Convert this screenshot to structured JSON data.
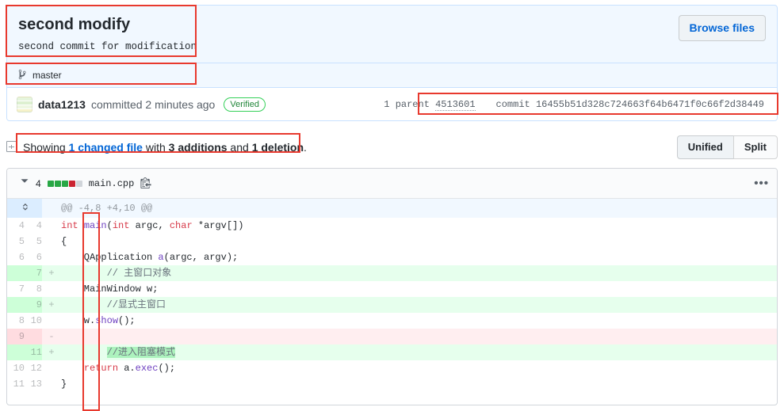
{
  "commit": {
    "title": "second modify",
    "description": "second commit for modification",
    "browse_files_label": "Browse files",
    "branch_icon": "git-branch-icon",
    "branch": "master",
    "author": "data1213",
    "committed_text": "committed 2 minutes ago",
    "verified_label": "Verified",
    "parent_label": "1 parent",
    "parent_sha": "4513601",
    "commit_label": "commit",
    "commit_sha": "16455b51d328c724663f64b6471f0c66f2d38449"
  },
  "showing": {
    "icon": "diff-file-icon",
    "prefix": "Showing ",
    "changed_files": "1 changed file",
    "middle": " with ",
    "additions": "3 additions",
    "conjunction": " and ",
    "deletions": "1 deletion",
    "suffix": ".",
    "unified_label": "Unified",
    "split_label": "Split"
  },
  "file": {
    "chevron_icon": "chevron-down-icon",
    "change_count": "4",
    "diffstat": [
      "add",
      "add",
      "add",
      "del",
      "neu"
    ],
    "name": "main.cpp",
    "copy_icon": "copy-path-icon",
    "menu_icon": "kebab-horizontal-icon",
    "fold_icon": "unfold-icon",
    "hunk_header": "@@ -4,8 +4,10 @@",
    "rows": [
      {
        "type": "hunk",
        "old": "",
        "new": "",
        "marker": "",
        "code": "@@ -4,8 +4,10 @@"
      },
      {
        "type": "context",
        "old": "4",
        "new": "4",
        "marker": "",
        "code": "int main(int argc, char *argv[])"
      },
      {
        "type": "context",
        "old": "5",
        "new": "5",
        "marker": "",
        "code": "{"
      },
      {
        "type": "context",
        "old": "6",
        "new": "6",
        "marker": "",
        "code": "    QApplication a(argc, argv);"
      },
      {
        "type": "add",
        "old": "",
        "new": "7",
        "marker": "+",
        "code": "        // 主窗口对象"
      },
      {
        "type": "context",
        "old": "7",
        "new": "8",
        "marker": "",
        "code": "    MainWindow w;"
      },
      {
        "type": "add",
        "old": "",
        "new": "9",
        "marker": "+",
        "code": "        //显式主窗口"
      },
      {
        "type": "context",
        "old": "8",
        "new": "10",
        "marker": "",
        "code": "    w.show();"
      },
      {
        "type": "del",
        "old": "9",
        "new": "",
        "marker": "-",
        "code": ""
      },
      {
        "type": "add",
        "old": "",
        "new": "11",
        "marker": "+",
        "code": "        //进入阻塞模式"
      },
      {
        "type": "context",
        "old": "10",
        "new": "12",
        "marker": "",
        "code": "    return a.exec();"
      },
      {
        "type": "context",
        "old": "11",
        "new": "13",
        "marker": "",
        "code": "}"
      }
    ]
  },
  "colors": {
    "accent": "#0366d6",
    "addition": "#28a745",
    "deletion": "#cb2431",
    "header_bg": "#f1f8ff",
    "annotation": "#e8392e"
  }
}
